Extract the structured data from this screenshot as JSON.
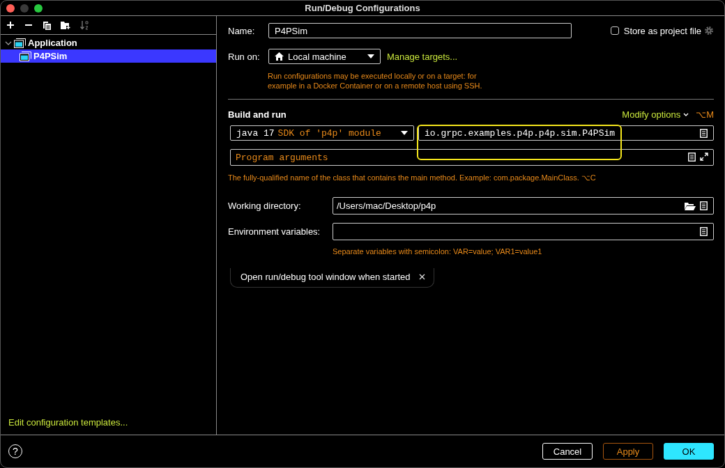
{
  "window": {
    "title": "Run/Debug Configurations"
  },
  "tree": [
    {
      "label": "Application",
      "expanded": true,
      "selected": false,
      "children": [
        {
          "label": "P4PSim",
          "selected": true
        }
      ]
    }
  ],
  "sidebar_link": "Edit configuration templates...",
  "name": {
    "label": "Name:",
    "value": "P4PSim"
  },
  "store_as_project_file": {
    "label": "Store as project file",
    "checked": false
  },
  "run_on": {
    "label": "Run on:",
    "value": "Local machine",
    "link": "Manage targets...",
    "note": "Run configurations may be executed locally or on a target: for example in a Docker Container or on a remote host using SSH."
  },
  "build_and_run": {
    "title": "Build and run",
    "modify_options": "Modify options",
    "shortcut": "⌥M",
    "jre": {
      "version": "java 17",
      "detail": "SDK of 'p4p' module"
    },
    "main_class": {
      "value": "io.grpc.examples.p4p.p4p.sim.P4PSim",
      "highlighted": true
    },
    "program_arguments": {
      "placeholder": "Program arguments"
    },
    "hint": "The fully-qualified name of the class that contains the main method. Example: com.package.MainClass. ⌥C"
  },
  "working_directory": {
    "label": "Working directory:",
    "value": "/Users/mac/Desktop/p4p"
  },
  "environment_variables": {
    "label": "Environment variables:",
    "hint": "Separate variables with semicolon: VAR=value; VAR1=value1"
  },
  "options": [
    {
      "label": "Open run/debug tool window when started"
    }
  ],
  "footer": {
    "help": "?",
    "buttons": [
      {
        "label": "Cancel",
        "kind": "cancel"
      },
      {
        "label": "Apply",
        "kind": "apply"
      },
      {
        "label": "OK",
        "kind": "ok"
      }
    ]
  }
}
